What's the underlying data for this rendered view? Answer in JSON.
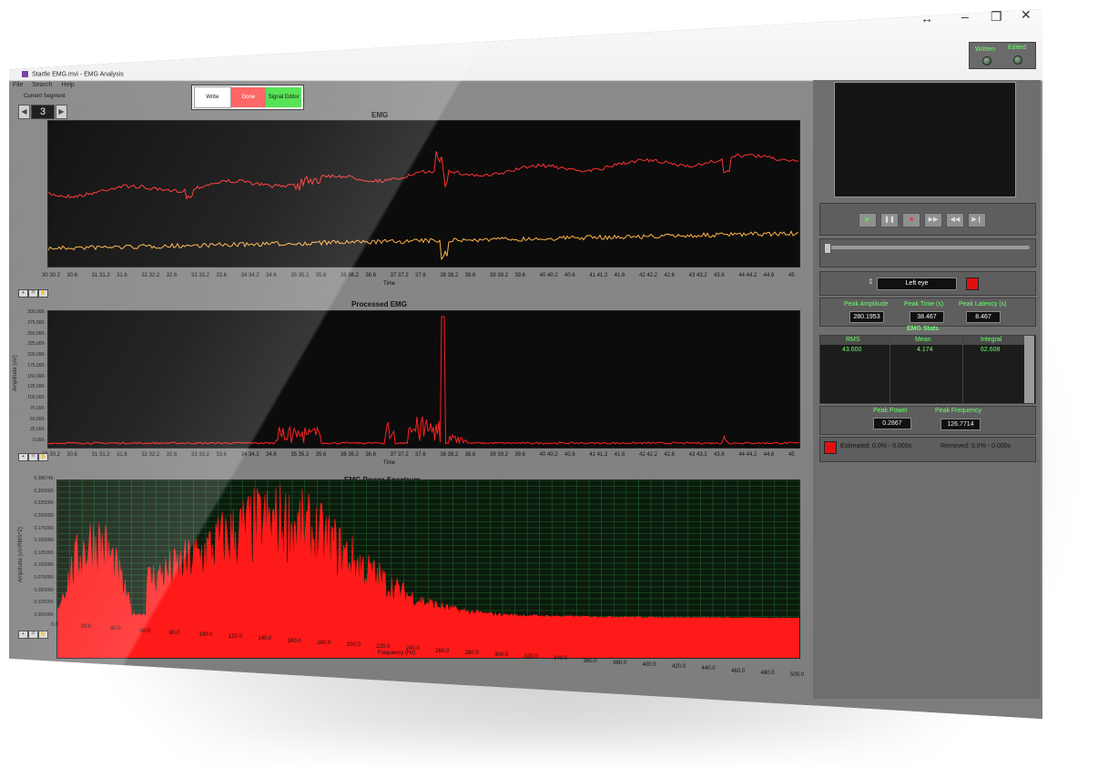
{
  "window": {
    "title": "Startle EMG.mvi - EMG Analysis",
    "titlebar_controls": [
      "↔",
      "–",
      "❐",
      "✕"
    ]
  },
  "menu": [
    "File",
    "Search",
    "Help"
  ],
  "segment": {
    "label": "Current Segment",
    "value": "3"
  },
  "toolbar": {
    "write": "Write",
    "done": "Done",
    "signal_editor": "Signal Editor"
  },
  "status_leds": {
    "written": "Written",
    "edited": "Edited"
  },
  "emg_chart": {
    "title": "EMG",
    "xlabel": "Time",
    "ticks": [
      "30 30.2",
      "30.6",
      "31 31.2",
      "31.6",
      "32 32.2",
      "32.6",
      "33 33.2",
      "33.6",
      "34 34.2",
      "34.6",
      "35 35.2",
      "35.6",
      "36 36.2",
      "36.6",
      "37 37.2",
      "37.6",
      "38 38.2",
      "38.6",
      "39 39.2",
      "39.6",
      "40 40.2",
      "40.6",
      "41 41.2",
      "41.6",
      "42 42.2",
      "42.6",
      "43 43.2",
      "43.6",
      "44 44.2",
      "44.6",
      "45"
    ]
  },
  "processed_chart": {
    "title": "Processed EMG",
    "xlabel": "Time",
    "ylabel": "Amplitude (uV)",
    "yticks": [
      "300,000-",
      "275,000-",
      "250,000-",
      "225,000-",
      "200,000-",
      "175,000-",
      "150,000-",
      "125,000-",
      "100,000-",
      "75,000-",
      "50,000-",
      "25,000-",
      "0.000-"
    ]
  },
  "spectrum_chart": {
    "title": "EMG Power Spectrum",
    "xlabel": "Frequency (Hz)",
    "ylabel": "Amplitude (uV/RMS^2)",
    "yticks": [
      "0.286745-",
      "0.250000-",
      "0.225000-",
      "0.200000-",
      "0.175000-",
      "0.150000-",
      "0.125000-",
      "0.100000-",
      "0.075000-",
      "0.050000-",
      "0.025000-",
      "0.000000-"
    ],
    "xticks": [
      "0.0",
      "20.0",
      "40.0",
      "60.0",
      "80.0",
      "100.0",
      "120.0",
      "140.0",
      "160.0",
      "180.0",
      "200.0",
      "220.0",
      "240.0",
      "260.0",
      "280.0",
      "300.0",
      "320.0",
      "340.0",
      "360.0",
      "380.0",
      "400.0",
      "420.0",
      "440.0",
      "460.0",
      "480.0",
      "500.0"
    ]
  },
  "eye_selector": {
    "value": "Left eye"
  },
  "peaks": {
    "amplitude_label": "Peak Amplitude",
    "amplitude": "280.1953",
    "time_label": "Peak Time (s)",
    "time": "38.467",
    "latency_label": "Peak Latency (s)",
    "latency": "8.467"
  },
  "emg_stats": {
    "title": "EMG Stats",
    "headers": [
      "RMS",
      "Mean",
      "Integral"
    ],
    "values": [
      "43.600",
      "4.174",
      "62.608"
    ]
  },
  "power": {
    "peak_power_label": "Peak Power",
    "peak_power": "0.2867",
    "peak_freq_label": "Peak Frequency",
    "peak_freq": "126.7714"
  },
  "removal": {
    "estimated": "Estimated:  0.0% - 0.000s",
    "removed": "Removed:  0.0% - 0.000s"
  },
  "colors": {
    "raw": "#ff3030",
    "trace2": "#ffb347",
    "spectrum": "#ff1a1a",
    "grid": "#1f6b2a",
    "lcd_text": "#6cff6c"
  }
}
